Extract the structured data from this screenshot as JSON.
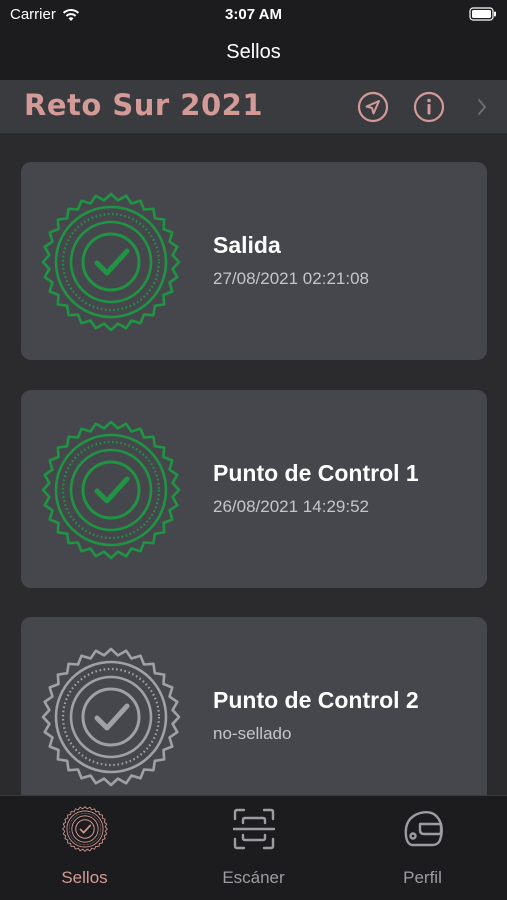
{
  "status_bar": {
    "carrier": "Carrier",
    "time": "3:07 AM"
  },
  "nav": {
    "title": "Sellos"
  },
  "event": {
    "title": "Reto Sur 2021",
    "title_color": "#d39a97"
  },
  "checkpoints": [
    {
      "name": "Salida",
      "detail": "27/08/2021 02:21:08",
      "stamped": true
    },
    {
      "name": "Punto de Control 1",
      "detail": "26/08/2021 14:29:52",
      "stamped": true
    },
    {
      "name": "Punto de Control 2",
      "detail": "no-sellado",
      "stamped": false
    }
  ],
  "tabs": [
    {
      "label": "Sellos",
      "icon": "seal-icon",
      "active": true
    },
    {
      "label": "Escáner",
      "icon": "scanner-icon",
      "active": false
    },
    {
      "label": "Perfil",
      "icon": "helmet-icon",
      "active": false
    }
  ],
  "colors": {
    "stamped": "#1f9443",
    "unstamped": "#9fa1a7",
    "accent": "#d39a97",
    "tab_inactive": "#9c9da1"
  }
}
